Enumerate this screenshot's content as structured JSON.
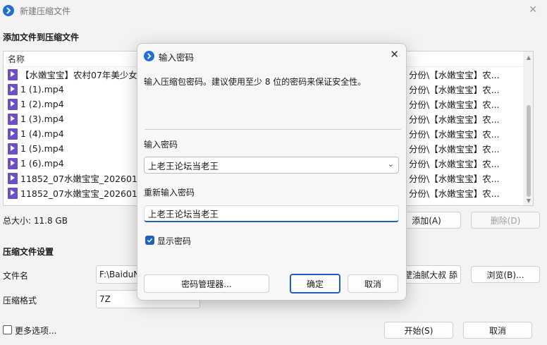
{
  "window": {
    "title": "新建压缩文件",
    "close_glyph": "✕"
  },
  "files_section": {
    "title": "添加文件到压缩文件",
    "column_name": "名称",
    "rows": [
      {
        "name": "【水嫩宝宝】农村07年美少女 成",
        "path": "分份\\【水嫩宝宝】农..."
      },
      {
        "name": "1 (1).mp4",
        "path": "分份\\【水嫩宝宝】农..."
      },
      {
        "name": "1 (2).mp4",
        "path": "分份\\【水嫩宝宝】农..."
      },
      {
        "name": "1 (3).mp4",
        "path": "分份\\【水嫩宝宝】农..."
      },
      {
        "name": "1 (4).mp4",
        "path": "分份\\【水嫩宝宝】农..."
      },
      {
        "name": "1 (5).mp4",
        "path": "分份\\【水嫩宝宝】农..."
      },
      {
        "name": "1 (6).mp4",
        "path": "分份\\【水嫩宝宝】农..."
      },
      {
        "name": "11852_07水嫩宝宝_20260119_",
        "path": "分份\\【水嫩宝宝】农..."
      },
      {
        "name": "11852_07水嫩宝宝_20260120_",
        "path": "分份\\【水嫩宝宝】农..."
      }
    ],
    "total_size": "总大小: 11.8 GB",
    "add_label": "添加(A)",
    "delete_label": "删除(D)"
  },
  "settings_section": {
    "title": "压缩文件设置",
    "filename_label": "文件名",
    "filename_value": "F:\\BaiduN",
    "filename_tail": "壁油腻大叔 舔",
    "browse_label": "浏览(B)...",
    "format_label": "压缩格式",
    "format_value": "7Z",
    "more_options": "更多选项...",
    "start_label": "开始(S)",
    "cancel_label": "取消"
  },
  "dialog": {
    "title": "输入密码",
    "close_glyph": "✕",
    "info": "输入压缩包密码。建议使用至少 8 位的密码来保证安全性。",
    "password_label": "输入密码",
    "password_value": "上老王论坛当老王",
    "confirm_label": "重新输入密码",
    "confirm_value": "上老王论坛当老王",
    "show_password": "显示密码",
    "show_password_checked": true,
    "manager_label": "密码管理器...",
    "ok_label": "确定",
    "cancel_label": "取消"
  },
  "colors": {
    "accent": "#1f5fbf",
    "file_icon": "#6a4fc8"
  }
}
